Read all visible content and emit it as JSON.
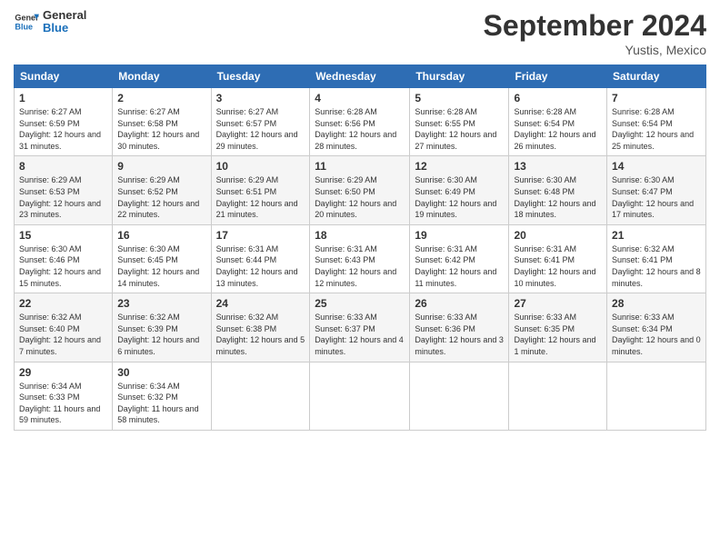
{
  "header": {
    "logo_line1": "General",
    "logo_line2": "Blue",
    "month_title": "September 2024",
    "location": "Yustis, Mexico"
  },
  "weekdays": [
    "Sunday",
    "Monday",
    "Tuesday",
    "Wednesday",
    "Thursday",
    "Friday",
    "Saturday"
  ],
  "weeks": [
    [
      {
        "day": "1",
        "sunrise": "6:27 AM",
        "sunset": "6:59 PM",
        "daylight": "12 hours and 31 minutes."
      },
      {
        "day": "2",
        "sunrise": "6:27 AM",
        "sunset": "6:58 PM",
        "daylight": "12 hours and 30 minutes."
      },
      {
        "day": "3",
        "sunrise": "6:27 AM",
        "sunset": "6:57 PM",
        "daylight": "12 hours and 29 minutes."
      },
      {
        "day": "4",
        "sunrise": "6:28 AM",
        "sunset": "6:56 PM",
        "daylight": "12 hours and 28 minutes."
      },
      {
        "day": "5",
        "sunrise": "6:28 AM",
        "sunset": "6:55 PM",
        "daylight": "12 hours and 27 minutes."
      },
      {
        "day": "6",
        "sunrise": "6:28 AM",
        "sunset": "6:54 PM",
        "daylight": "12 hours and 26 minutes."
      },
      {
        "day": "7",
        "sunrise": "6:28 AM",
        "sunset": "6:54 PM",
        "daylight": "12 hours and 25 minutes."
      }
    ],
    [
      {
        "day": "8",
        "sunrise": "6:29 AM",
        "sunset": "6:53 PM",
        "daylight": "12 hours and 23 minutes."
      },
      {
        "day": "9",
        "sunrise": "6:29 AM",
        "sunset": "6:52 PM",
        "daylight": "12 hours and 22 minutes."
      },
      {
        "day": "10",
        "sunrise": "6:29 AM",
        "sunset": "6:51 PM",
        "daylight": "12 hours and 21 minutes."
      },
      {
        "day": "11",
        "sunrise": "6:29 AM",
        "sunset": "6:50 PM",
        "daylight": "12 hours and 20 minutes."
      },
      {
        "day": "12",
        "sunrise": "6:30 AM",
        "sunset": "6:49 PM",
        "daylight": "12 hours and 19 minutes."
      },
      {
        "day": "13",
        "sunrise": "6:30 AM",
        "sunset": "6:48 PM",
        "daylight": "12 hours and 18 minutes."
      },
      {
        "day": "14",
        "sunrise": "6:30 AM",
        "sunset": "6:47 PM",
        "daylight": "12 hours and 17 minutes."
      }
    ],
    [
      {
        "day": "15",
        "sunrise": "6:30 AM",
        "sunset": "6:46 PM",
        "daylight": "12 hours and 15 minutes."
      },
      {
        "day": "16",
        "sunrise": "6:30 AM",
        "sunset": "6:45 PM",
        "daylight": "12 hours and 14 minutes."
      },
      {
        "day": "17",
        "sunrise": "6:31 AM",
        "sunset": "6:44 PM",
        "daylight": "12 hours and 13 minutes."
      },
      {
        "day": "18",
        "sunrise": "6:31 AM",
        "sunset": "6:43 PM",
        "daylight": "12 hours and 12 minutes."
      },
      {
        "day": "19",
        "sunrise": "6:31 AM",
        "sunset": "6:42 PM",
        "daylight": "12 hours and 11 minutes."
      },
      {
        "day": "20",
        "sunrise": "6:31 AM",
        "sunset": "6:41 PM",
        "daylight": "12 hours and 10 minutes."
      },
      {
        "day": "21",
        "sunrise": "6:32 AM",
        "sunset": "6:41 PM",
        "daylight": "12 hours and 8 minutes."
      }
    ],
    [
      {
        "day": "22",
        "sunrise": "6:32 AM",
        "sunset": "6:40 PM",
        "daylight": "12 hours and 7 minutes."
      },
      {
        "day": "23",
        "sunrise": "6:32 AM",
        "sunset": "6:39 PM",
        "daylight": "12 hours and 6 minutes."
      },
      {
        "day": "24",
        "sunrise": "6:32 AM",
        "sunset": "6:38 PM",
        "daylight": "12 hours and 5 minutes."
      },
      {
        "day": "25",
        "sunrise": "6:33 AM",
        "sunset": "6:37 PM",
        "daylight": "12 hours and 4 minutes."
      },
      {
        "day": "26",
        "sunrise": "6:33 AM",
        "sunset": "6:36 PM",
        "daylight": "12 hours and 3 minutes."
      },
      {
        "day": "27",
        "sunrise": "6:33 AM",
        "sunset": "6:35 PM",
        "daylight": "12 hours and 1 minute."
      },
      {
        "day": "28",
        "sunrise": "6:33 AM",
        "sunset": "6:34 PM",
        "daylight": "12 hours and 0 minutes."
      }
    ],
    [
      {
        "day": "29",
        "sunrise": "6:34 AM",
        "sunset": "6:33 PM",
        "daylight": "11 hours and 59 minutes."
      },
      {
        "day": "30",
        "sunrise": "6:34 AM",
        "sunset": "6:32 PM",
        "daylight": "11 hours and 58 minutes."
      },
      null,
      null,
      null,
      null,
      null
    ]
  ]
}
